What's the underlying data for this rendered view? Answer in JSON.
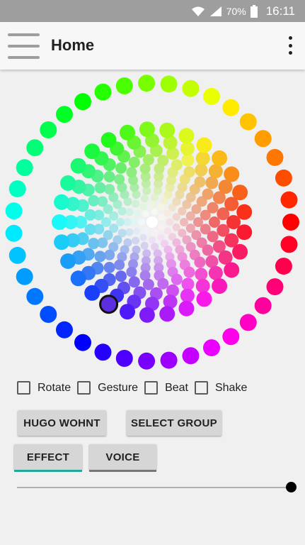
{
  "status_bar": {
    "battery": "70%",
    "time": "16:11",
    "icons": [
      "wifi-icon",
      "signal-icon",
      "battery-icon"
    ]
  },
  "app_bar": {
    "title": "Home",
    "menu_icon": "hamburger-menu-icon",
    "overflow_icon": "more-vertical-icon"
  },
  "color_wheel": {
    "selected_color": "#5b2ee0",
    "rings": 12
  },
  "options": {
    "checkboxes": [
      {
        "label": "Rotate",
        "checked": false
      },
      {
        "label": "Gesture",
        "checked": false
      },
      {
        "label": "Beat",
        "checked": false
      },
      {
        "label": "Shake",
        "checked": false
      }
    ]
  },
  "actions": {
    "group_button": "HUGO WOHNT",
    "select_group_button": "SELECT GROUP"
  },
  "tabs": {
    "effect": "EFFECT",
    "voice": "VOICE",
    "active": "effect",
    "active_color": "#26a69a",
    "inactive_color": "#777777"
  },
  "slider": {
    "value": 1.0
  }
}
